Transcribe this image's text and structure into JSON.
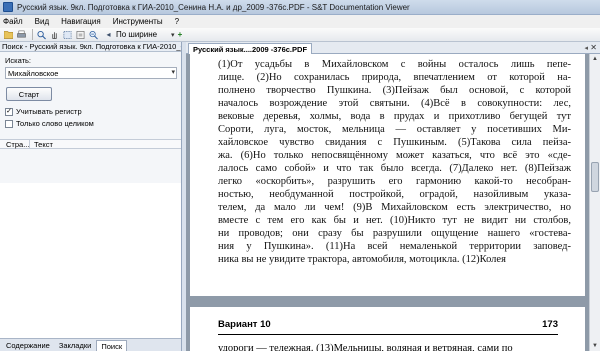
{
  "window": {
    "title": "Русский язык. 9кл. Подготовка к ГИА-2010_Сенина Н.А. и др_2009 -376с.PDF - S&T Documentation Viewer"
  },
  "menu": [
    "Файл",
    "Вид",
    "Навигация",
    "Инструменты",
    "?"
  ],
  "toolbar": {
    "zoom_label": "По ширине",
    "icons": [
      "open-icon",
      "print-icon",
      "find-icon",
      "pan-icon",
      "select-icon",
      "tool-icon",
      "zoom-icon",
      "page-prev-icon",
      "add-icon"
    ]
  },
  "left_panel": {
    "header": "Поиск - Русский язык. 9кл. Подготовка к ГИА-2010_Се",
    "search_label": "Искать:",
    "search_value": "Михайловское",
    "start_button": "Старт",
    "case_checkbox": {
      "label": "Учитывать регистр",
      "checked": true
    },
    "whole_word_checkbox": {
      "label": "Только слово целиком",
      "checked": false
    },
    "results_columns": [
      "Стра...",
      "Текст"
    ],
    "bottom_tabs": [
      "Содержание",
      "Закладки",
      "Поиск"
    ],
    "active_tab": "Поиск"
  },
  "document": {
    "tab_label": "Русский язык....2009 -376с.PDF",
    "page1_lines": [
      "(1)От усадьбы в Михайловском с войны осталось лишь пепе-",
      "лище. (2)Но сохранилась природа, впечатлением от которой на-",
      "полнено творчество Пушкина. (3)Пейзаж был основой, с которой",
      "началось возрождение этой святыни. (4)Всё в совокупности: лес,",
      "вековые деревья, холмы, вода в прудах и прихотливо бегущей тут",
      "Сороти, луга, мосток, мельница — оставляет у посетивших Ми-",
      "хайловское чувство свидания с Пушкиным. (5)Такова сила пейза-",
      "жа. (6)Но только непосвящённому может казаться, что всё это «сде-",
      "лалось само собой» и что так было всегда. (7)Далеко нет. (8)Пейзаж",
      "легко «оскорбить», разрушить его гармонию какой-то несобран-",
      "ностью, необдуманной постройкой, оградой, назойливым указа-",
      "телем, да мало ли чем! (9)В Михайловском есть электричество, но",
      "вместе с тем его как бы и нет. (10)Никто тут не видит ни столбов,",
      "ни проводов; они сразу бы разрушили ощущение нашего «гостева-",
      "ния у Пушкина». (11)На всей немаленькой территории заповед-",
      "ника вы не увидите трактора, автомобиля, мотоцикла. (12)Колея"
    ],
    "page2_header_left": "Вариант 10",
    "page2_header_right": "173",
    "page2_line": "удороги — тележная. (13)Мельницы, водяная и ветряная, сами по"
  }
}
